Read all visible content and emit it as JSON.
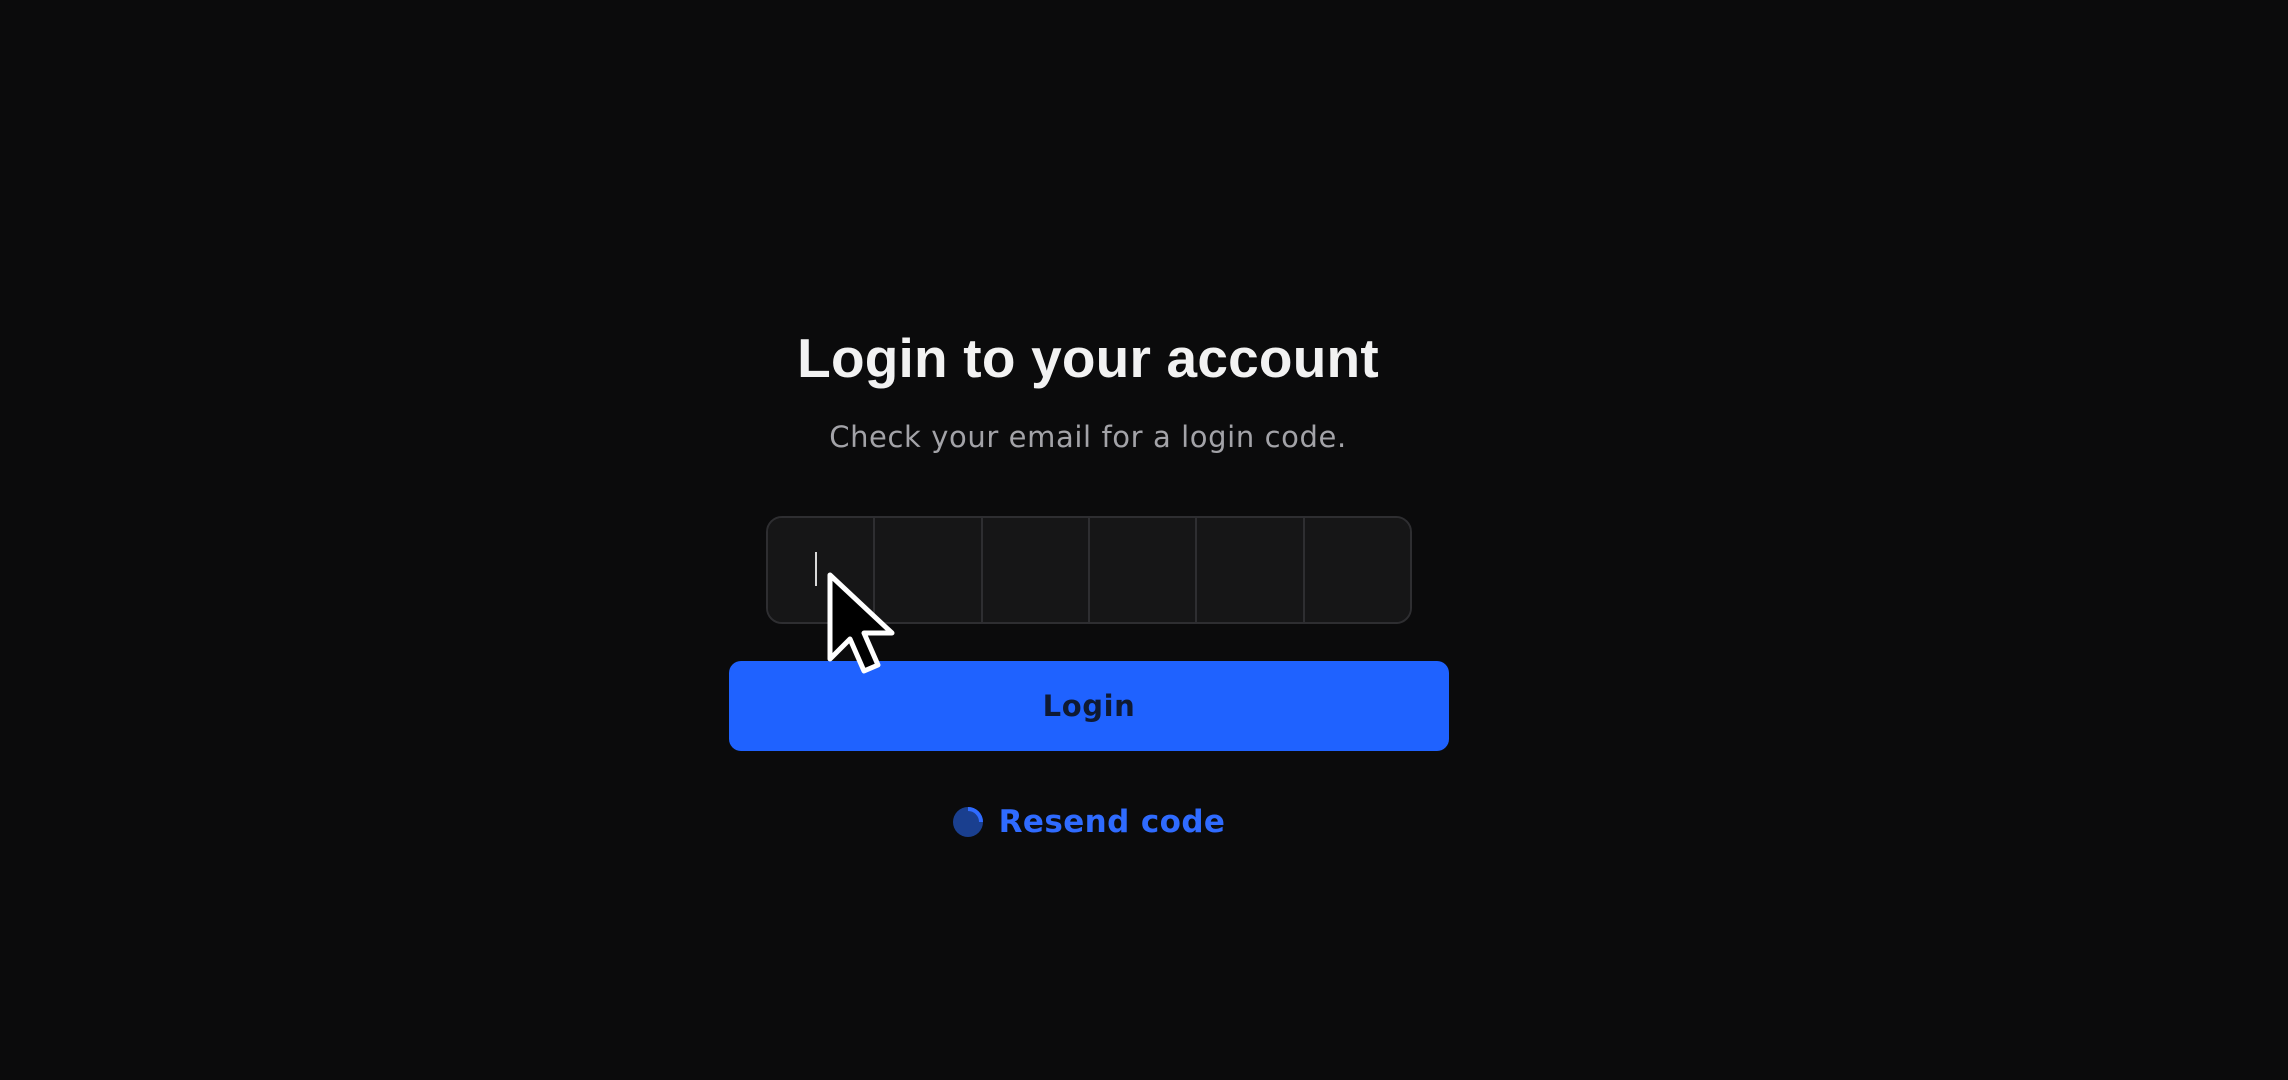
{
  "login": {
    "title": "Login to your account",
    "subtitle": "Check your email for a login code.",
    "otp": {
      "length": 6,
      "values": [
        "",
        "",
        "",
        "",
        "",
        ""
      ],
      "focused_index": 0
    },
    "login_button_label": "Login",
    "resend_label": "Resend code",
    "resend_icon": "refresh-circle-icon"
  },
  "colors": {
    "background": "#0b0b0c",
    "accent": "#1f62ff",
    "link": "#2f6bff"
  }
}
